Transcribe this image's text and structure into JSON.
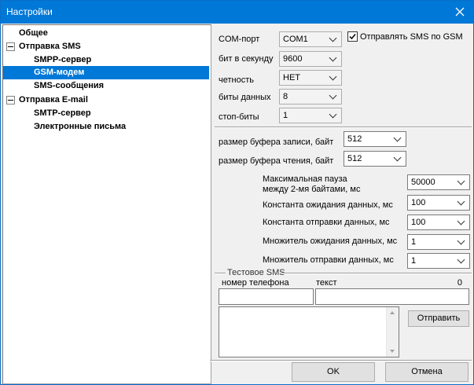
{
  "window": {
    "title": "Настройки"
  },
  "tree": {
    "items": [
      {
        "label": "Общее"
      },
      {
        "label": "Отправка SMS"
      },
      {
        "label": "SMPP-сервер"
      },
      {
        "label": "GSM-модем"
      },
      {
        "label": "SMS-сообщения"
      },
      {
        "label": "Отправка E-mail"
      },
      {
        "label": "SMTP-сервер"
      },
      {
        "label": "Электронные письма"
      }
    ]
  },
  "port": {
    "com_label": "COM-порт",
    "com_value": "COM1",
    "baud_label": "бит в секунду",
    "baud_value": "9600",
    "parity_label": "четность",
    "parity_value": "НЕТ",
    "databits_label": "биты данных",
    "databits_value": "8",
    "stopbits_label": "стоп-биты",
    "stopbits_value": "1",
    "send_via_gsm_label": "Отправлять SMS по GSM",
    "send_via_gsm_checked": true
  },
  "buffers": {
    "write_label": "размер буфера записи, байт",
    "write_value": "512",
    "read_label": "размер буфера чтения, байт",
    "read_value": "512"
  },
  "timeouts": {
    "max_pause_label_1": "Максимальная пауза",
    "max_pause_label_2": "между 2-мя байтами, мс",
    "max_pause_value": "50000",
    "read_const_label": "Константа ожидания данных, мс",
    "read_const_value": "100",
    "write_const_label": "Константа отправки данных, мс",
    "write_const_value": "100",
    "read_mult_label": "Множитель ожидания данных, мс",
    "read_mult_value": "1",
    "write_mult_label": "Множитель отправки данных, мс",
    "write_mult_value": "1"
  },
  "test_sms": {
    "group_label": "Тестовое SMS",
    "phone_label": "номер телефона",
    "phone_value": "",
    "text_label": "текст",
    "char_count": "0",
    "text_value": "",
    "send_button": "Отправить"
  },
  "footer": {
    "ok_button": "OK",
    "cancel_button": "Отмена"
  }
}
